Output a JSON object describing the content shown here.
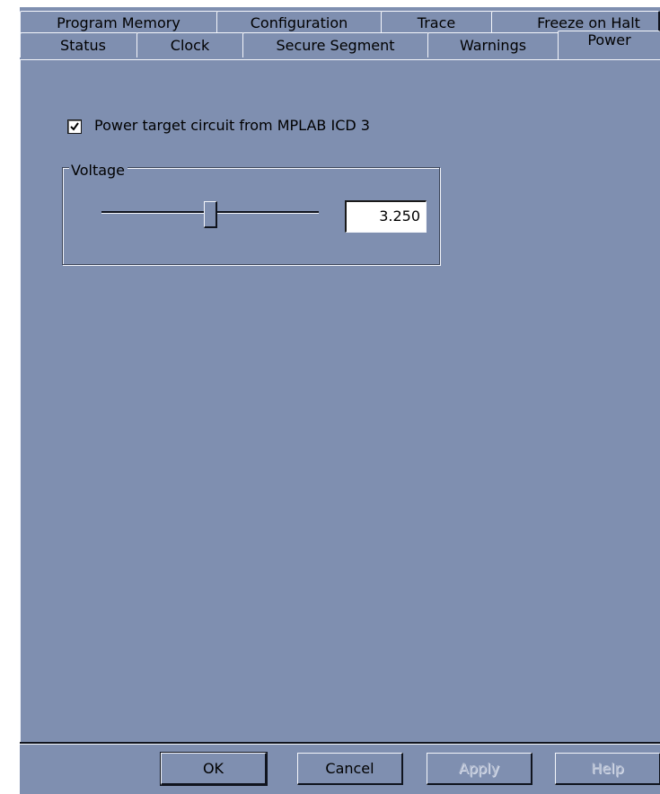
{
  "tabs_row1": [
    "Program Memory",
    "Configuration",
    "Trace",
    "Freeze on Halt"
  ],
  "tabs_row2": [
    "Status",
    "Clock",
    "Secure Segment",
    "Warnings",
    "Power"
  ],
  "active_tab": "Power",
  "power": {
    "checkbox_label": "Power target circuit from MPLAB ICD 3",
    "checkbox_checked": true,
    "voltage_group_label": "Voltage",
    "voltage_value": "3.250",
    "slider_level": 0.5
  },
  "buttons": {
    "ok": "OK",
    "cancel": "Cancel",
    "apply": "Apply",
    "help": "Help"
  },
  "icons": [
    "check-icon"
  ],
  "colors": {
    "dialog_bg": "#7f8fb0",
    "highlight": "#f4f6fb",
    "shadow": "#10141e"
  }
}
